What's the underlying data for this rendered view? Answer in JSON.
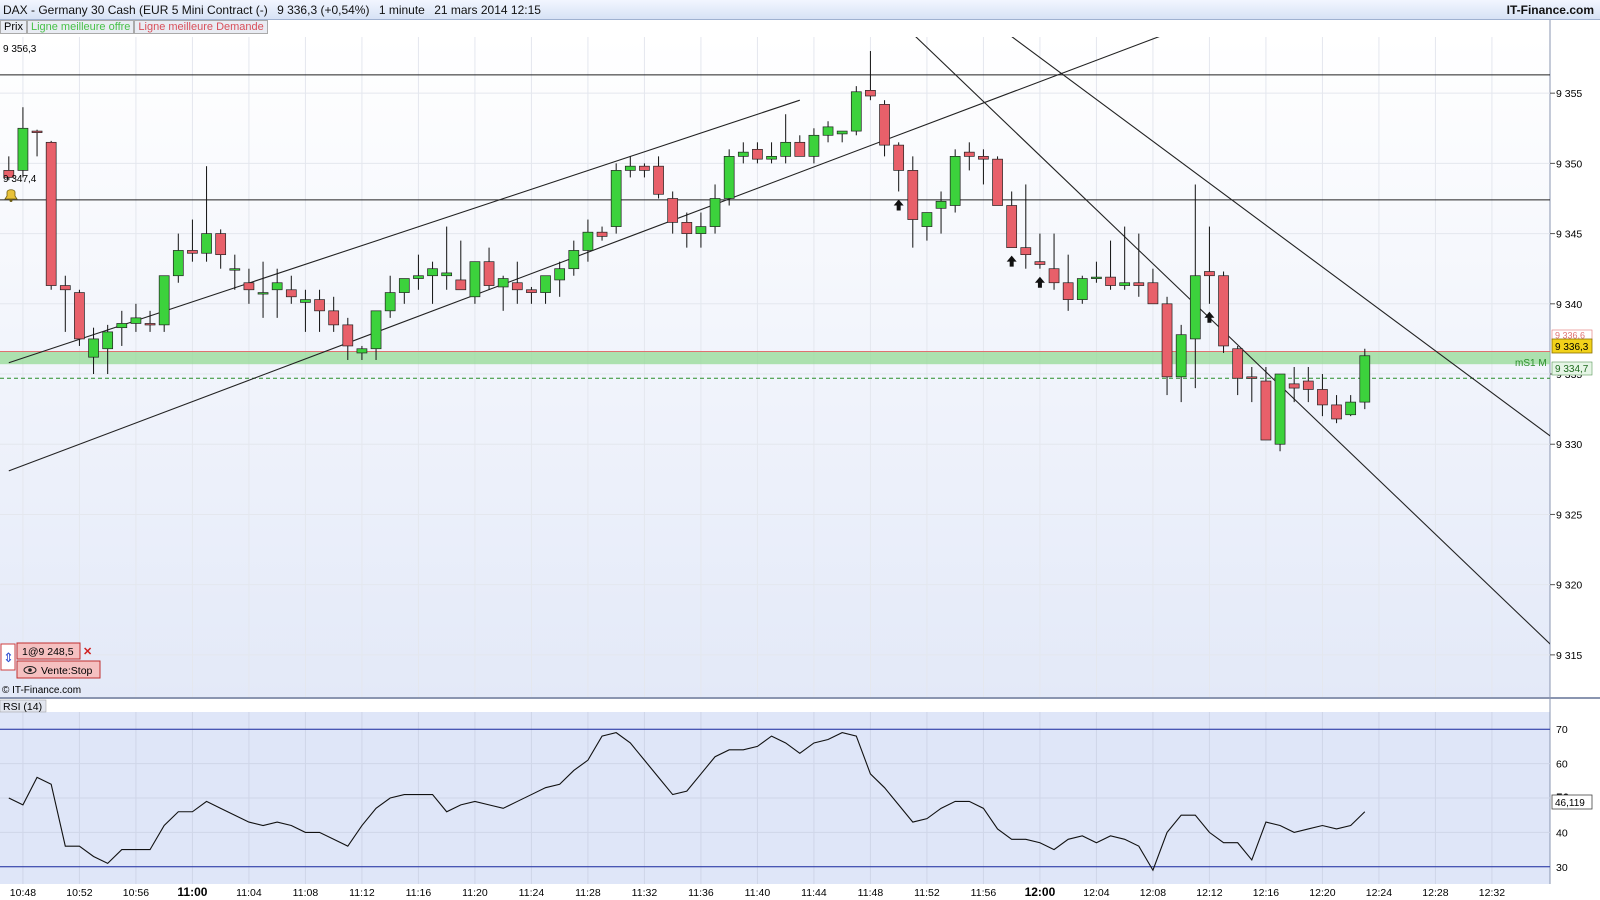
{
  "titlebar": {
    "instrument": "DAX - Germany 30 Cash (EUR 5 Mini Contract (-)",
    "quote": "9 336,3 (+0,54%)",
    "timeframe": "1 minute",
    "datetime": "21 mars 2014 12:15",
    "brand": "IT-Finance.com"
  },
  "legend": {
    "price": "Prix",
    "best_offer": "Ligne meilleure offre",
    "best_demand": "Ligne meilleure Demande"
  },
  "labels": {
    "level_high": "9 356,3",
    "level_mid": "9 347,4",
    "ms1": "mS1 M",
    "badge_top": "9 336,6",
    "badge_price": "9 336,3",
    "badge_ms1": "9 334,7",
    "copyright": "© IT-Finance.com",
    "order_qty": "1@9 248,5",
    "order_type": "Vente:Stop",
    "rsi_title": "RSI (14)",
    "rsi_value": "46,119"
  },
  "colors": {
    "up": "#3cd23c",
    "down": "#e8606a",
    "zone": "#8fd98f",
    "rsi_bg": "#dfe6f8"
  },
  "chart_data": {
    "type": "candlestick",
    "title": "DAX - Germany 30 Cash (EUR 5 Mini Contract (-)",
    "ylim": [
      9312,
      9359
    ],
    "yticks": [
      "9 315",
      "9 320",
      "9 325",
      "9 330",
      "9 335",
      "9 340",
      "9 345",
      "9 350",
      "9 355"
    ],
    "ytick_values": [
      9315,
      9320,
      9325,
      9330,
      9335,
      9340,
      9345,
      9350,
      9355
    ],
    "xticks": [
      "10:48",
      "10:52",
      "10:56",
      "11:00",
      "11:04",
      "11:08",
      "11:12",
      "11:16",
      "11:20",
      "11:24",
      "11:28",
      "11:32",
      "11:36",
      "11:40",
      "11:44",
      "11:48",
      "11:52",
      "11:56",
      "12:00",
      "12:04",
      "12:08",
      "12:12",
      "12:16",
      "12:20",
      "12:24",
      "12:28",
      "12:32"
    ],
    "xticks_bold": [
      "11:00",
      "12:00"
    ],
    "ohlc": [
      [
        9349.5,
        9350.5,
        9348.8,
        9349.0
      ],
      [
        9349.5,
        9354.0,
        9349.0,
        9352.5
      ],
      [
        9352.3,
        9352.4,
        9350.5,
        9352.2
      ],
      [
        9351.5,
        9351.6,
        9341.0,
        9341.3
      ],
      [
        9341.3,
        9342.0,
        9338.0,
        9341.0
      ],
      [
        9340.8,
        9341.0,
        9337.0,
        9337.5
      ],
      [
        9336.2,
        9338.3,
        9335.0,
        9337.5
      ],
      [
        9336.8,
        9338.5,
        9335.0,
        9338.0
      ],
      [
        9338.3,
        9339.5,
        9337.0,
        9338.6
      ],
      [
        9338.6,
        9340.0,
        9338.0,
        9339.0
      ],
      [
        9338.6,
        9339.5,
        9338.0,
        9338.5
      ],
      [
        9338.5,
        9342.0,
        9338.0,
        9342.0
      ],
      [
        9342.0,
        9345.0,
        9341.5,
        9343.8
      ],
      [
        9343.8,
        9346.0,
        9343.0,
        9343.6
      ],
      [
        9343.6,
        9349.8,
        9343.0,
        9345.0
      ],
      [
        9345.0,
        9345.3,
        9342.5,
        9343.5
      ],
      [
        9342.5,
        9343.5,
        9341.0,
        9342.5
      ],
      [
        9341.5,
        9342.5,
        9340.0,
        9341.0
      ],
      [
        9340.8,
        9343.0,
        9339.0,
        9340.8
      ],
      [
        9341.0,
        9342.5,
        9339.0,
        9341.5
      ],
      [
        9341.0,
        9342.0,
        9340.0,
        9340.5
      ],
      [
        9340.1,
        9341.0,
        9338.0,
        9340.3
      ],
      [
        9340.3,
        9341.0,
        9338.0,
        9339.5
      ],
      [
        9339.5,
        9340.5,
        9338.0,
        9338.5
      ],
      [
        9338.5,
        9339.0,
        9336.0,
        9337.0
      ],
      [
        9336.5,
        9337.0,
        9336.0,
        9336.8
      ],
      [
        9336.8,
        9339.5,
        9336.0,
        9339.5
      ],
      [
        9339.5,
        9342.0,
        9339.0,
        9340.8
      ],
      [
        9340.8,
        9341.5,
        9340.0,
        9341.8
      ],
      [
        9341.8,
        9343.5,
        9341.0,
        9342.0
      ],
      [
        9342.0,
        9343.0,
        9340.0,
        9342.5
      ],
      [
        9342.0,
        9345.5,
        9341.0,
        9342.2
      ],
      [
        9341.7,
        9344.5,
        9341.0,
        9341.0
      ],
      [
        9340.5,
        9342.0,
        9340.0,
        9343.0
      ],
      [
        9343.0,
        9344.0,
        9341.0,
        9341.3
      ],
      [
        9341.2,
        9342.0,
        9339.5,
        9341.8
      ],
      [
        9341.5,
        9343.0,
        9340.0,
        9341.0
      ],
      [
        9341.0,
        9341.2,
        9340.0,
        9340.8
      ],
      [
        9340.8,
        9342.0,
        9340.0,
        9342.0
      ],
      [
        9341.7,
        9343.0,
        9340.5,
        9342.5
      ],
      [
        9342.5,
        9344.5,
        9342.0,
        9343.8
      ],
      [
        9343.8,
        9346.0,
        9343.0,
        9345.1
      ],
      [
        9345.1,
        9345.5,
        9344.5,
        9344.8
      ],
      [
        9345.5,
        9350.0,
        9345.0,
        9349.5
      ],
      [
        9349.5,
        9350.5,
        9349.0,
        9349.8
      ],
      [
        9349.8,
        9350.0,
        9349.0,
        9349.5
      ],
      [
        9349.8,
        9350.5,
        9347.5,
        9347.8
      ],
      [
        9347.5,
        9348.0,
        9345.0,
        9345.8
      ],
      [
        9345.8,
        9346.5,
        9344.0,
        9345.0
      ],
      [
        9345.0,
        9346.5,
        9344.0,
        9345.5
      ],
      [
        9345.5,
        9348.5,
        9345.0,
        9347.5
      ],
      [
        9347.5,
        9351.0,
        9347.0,
        9350.5
      ],
      [
        9350.5,
        9351.5,
        9350.0,
        9350.8
      ],
      [
        9351.0,
        9351.5,
        9350.0,
        9350.3
      ],
      [
        9350.3,
        9351.5,
        9350.0,
        9350.5
      ],
      [
        9350.5,
        9353.5,
        9350.0,
        9351.5
      ],
      [
        9351.5,
        9352.0,
        9350.5,
        9350.5
      ],
      [
        9350.5,
        9352.5,
        9350.0,
        9352.0
      ],
      [
        9352.0,
        9353.0,
        9351.5,
        9352.6
      ],
      [
        9352.1,
        9352.3,
        9351.5,
        9352.3
      ],
      [
        9352.3,
        9355.5,
        9352.0,
        9355.1
      ],
      [
        9355.2,
        9358.0,
        9354.5,
        9354.8
      ],
      [
        9354.2,
        9354.5,
        9350.5,
        9351.3
      ],
      [
        9351.3,
        9351.5,
        9348.0,
        9349.5
      ],
      [
        9349.5,
        9350.5,
        9344.0,
        9346.0
      ],
      [
        9345.5,
        9346.5,
        9344.5,
        9346.5
      ],
      [
        9346.8,
        9348.0,
        9345.0,
        9347.3
      ],
      [
        9347.0,
        9351.0,
        9346.5,
        9350.5
      ],
      [
        9350.8,
        9351.5,
        9349.5,
        9350.5
      ],
      [
        9350.5,
        9351.0,
        9348.5,
        9350.3
      ],
      [
        9350.3,
        9350.5,
        9347.0,
        9347.0
      ],
      [
        9347.0,
        9348.0,
        9344.0,
        9344.0
      ],
      [
        9344.0,
        9348.5,
        9342.5,
        9343.5
      ],
      [
        9343.0,
        9345.0,
        9342.5,
        9342.8
      ],
      [
        9342.5,
        9345.0,
        9341.0,
        9341.5
      ],
      [
        9341.5,
        9343.5,
        9339.5,
        9340.3
      ],
      [
        9340.3,
        9342.0,
        9340.0,
        9341.8
      ],
      [
        9341.8,
        9343.0,
        9341.5,
        9341.9
      ],
      [
        9341.9,
        9344.5,
        9341.0,
        9341.3
      ],
      [
        9341.3,
        9345.5,
        9341.0,
        9341.5
      ],
      [
        9341.5,
        9345.0,
        9340.5,
        9341.3
      ],
      [
        9341.5,
        9342.5,
        9340.0,
        9340.0
      ],
      [
        9340.0,
        9340.5,
        9333.5,
        9334.8
      ],
      [
        9334.8,
        9338.5,
        9333.0,
        9337.8
      ],
      [
        9337.5,
        9348.5,
        9334.0,
        9342.0
      ],
      [
        9342.3,
        9345.5,
        9340.0,
        9342.0
      ],
      [
        9342.0,
        9342.3,
        9336.5,
        9337.0
      ],
      [
        9336.8,
        9337.0,
        9333.5,
        9334.7
      ],
      [
        9334.8,
        9335.5,
        9333.0,
        9334.7
      ],
      [
        9334.5,
        9335.5,
        9333.0,
        9330.3
      ],
      [
        9330.0,
        9335.0,
        9329.5,
        9335.0
      ],
      [
        9334.3,
        9335.5,
        9333.0,
        9334.0
      ],
      [
        9334.5,
        9335.5,
        9333.0,
        9333.9
      ],
      [
        9333.9,
        9335.0,
        9332.0,
        9332.8
      ],
      [
        9332.8,
        9333.5,
        9331.5,
        9331.8
      ],
      [
        9332.1,
        9333.5,
        9332.0,
        9333.0
      ],
      [
        9333.0,
        9336.8,
        9332.5,
        9336.3
      ]
    ],
    "annotations": {
      "horizontal_lines": [
        9356.3,
        9347.4
      ],
      "best_bid_ask_zone": [
        9335.7,
        9336.6
      ],
      "ms1_level": 9334.7,
      "trendlines": [
        {
          "from": [
            0,
            9335.8
          ],
          "to": [
            56,
            9354.5
          ]
        },
        {
          "from": [
            0,
            9328.1
          ],
          "to": [
            84,
            9360.0
          ]
        },
        {
          "from": [
            58,
            9365.0
          ],
          "to": [
            112,
            9313.0
          ]
        },
        {
          "from": [
            63,
            9365.0
          ],
          "to": [
            126,
            9318.0
          ]
        }
      ],
      "arrows_up": [
        63,
        71,
        73,
        85
      ]
    },
    "rsi": {
      "title": "RSI (14)",
      "period": 14,
      "ylim": [
        25,
        75
      ],
      "levels": [
        30,
        70
      ],
      "yticks": [
        "30",
        "40",
        "50",
        "60",
        "70"
      ],
      "ytick_values": [
        30,
        40,
        50,
        60,
        70
      ],
      "values": [
        50,
        48,
        56,
        54,
        36,
        36,
        33,
        31,
        35,
        35,
        35,
        42,
        46,
        46,
        49,
        47,
        45,
        43,
        42,
        43,
        42,
        40,
        40,
        38,
        36,
        42,
        47,
        50,
        51,
        51,
        51,
        46,
        48,
        49,
        48,
        47,
        49,
        51,
        53,
        54,
        58,
        61,
        68,
        69,
        66,
        61,
        56,
        51,
        52,
        57,
        62,
        64,
        64,
        65,
        68,
        66,
        63,
        66,
        67,
        69,
        68,
        57,
        53,
        48,
        43,
        44,
        47,
        49,
        49,
        47,
        41,
        38,
        38,
        37,
        35,
        38,
        39,
        37,
        39,
        38,
        36,
        29,
        40,
        45,
        45,
        40,
        37,
        37,
        32,
        43,
        42,
        40,
        41,
        42,
        41,
        42,
        46
      ],
      "last": 46.119
    }
  }
}
